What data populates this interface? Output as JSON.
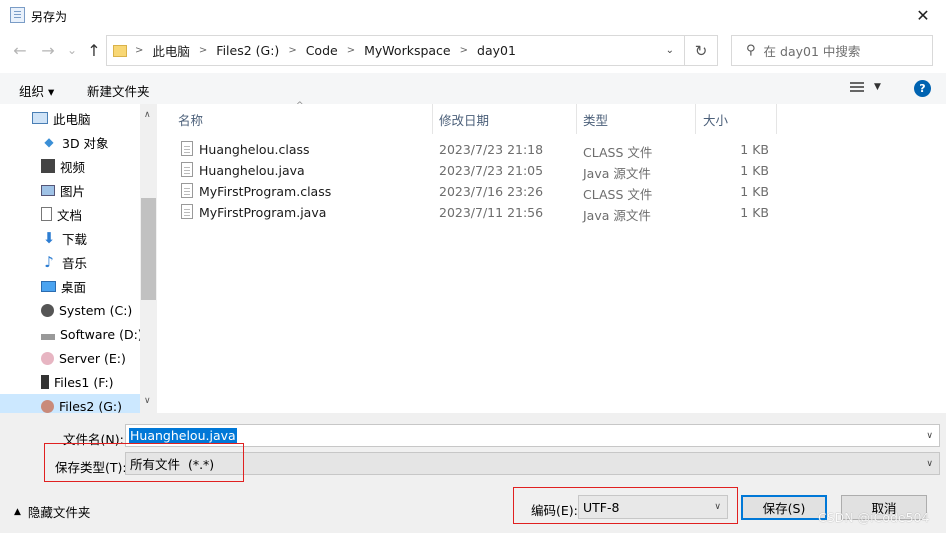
{
  "window": {
    "title": "另存为",
    "close_glyph": "✕"
  },
  "nav": {
    "back": "←",
    "forward": "→",
    "recent": "⌄",
    "up": "↑"
  },
  "address": {
    "crumbs": [
      "此电脑",
      "Files2 (G:)",
      "Code",
      "MyWorkspace",
      "day01"
    ],
    "refresh_glyph": "↻"
  },
  "search": {
    "placeholder": "在 day01 中搜索"
  },
  "toolbar": {
    "organize": "组织 ▾",
    "new_folder": "新建文件夹",
    "help": "?"
  },
  "sidebar": {
    "items": [
      {
        "label": "此电脑",
        "icon": "computer-icon"
      },
      {
        "label": "3D 对象",
        "icon": "cube-icon"
      },
      {
        "label": "视频",
        "icon": "video-icon"
      },
      {
        "label": "图片",
        "icon": "picture-icon"
      },
      {
        "label": "文档",
        "icon": "document-icon"
      },
      {
        "label": "下载",
        "icon": "download-icon"
      },
      {
        "label": "音乐",
        "icon": "music-icon"
      },
      {
        "label": "桌面",
        "icon": "desktop-icon"
      },
      {
        "label": "System (C:)",
        "icon": "drive-icon"
      },
      {
        "label": "Software (D:)",
        "icon": "drive-icon"
      },
      {
        "label": "Server (E:)",
        "icon": "drive-icon"
      },
      {
        "label": "Files1 (F:)",
        "icon": "drive-icon"
      },
      {
        "label": "Files2 (G:)",
        "icon": "drive-icon"
      }
    ]
  },
  "columns": {
    "name": "名称",
    "date": "修改日期",
    "type": "类型",
    "size": "大小"
  },
  "files": [
    {
      "name": "Huanghelou.class",
      "date": "2023/7/23 21:18",
      "type": "CLASS 文件",
      "size": "1 KB"
    },
    {
      "name": "Huanghelou.java",
      "date": "2023/7/23 21:05",
      "type": "Java 源文件",
      "size": "1 KB"
    },
    {
      "name": "MyFirstProgram.class",
      "date": "2023/7/16 23:26",
      "type": "CLASS 文件",
      "size": "1 KB"
    },
    {
      "name": "MyFirstProgram.java",
      "date": "2023/7/11 21:56",
      "type": "Java 源文件",
      "size": "1 KB"
    }
  ],
  "form": {
    "filename_label": "文件名(N):",
    "filename_value": "Huanghelou.java",
    "filetype_label": "保存类型(T):",
    "filetype_value": "所有文件  (*.*)",
    "encoding_label": "编码(E):",
    "encoding_value": "UTF-8",
    "hide_folders": "隐藏文件夹",
    "save": "保存(S)",
    "cancel": "取消"
  },
  "watermark": "CSDN @iCode504",
  "colors": {
    "highlight": "#0078d7",
    "annotation_red": "#e02020",
    "accent_blue": "#0063b1"
  }
}
